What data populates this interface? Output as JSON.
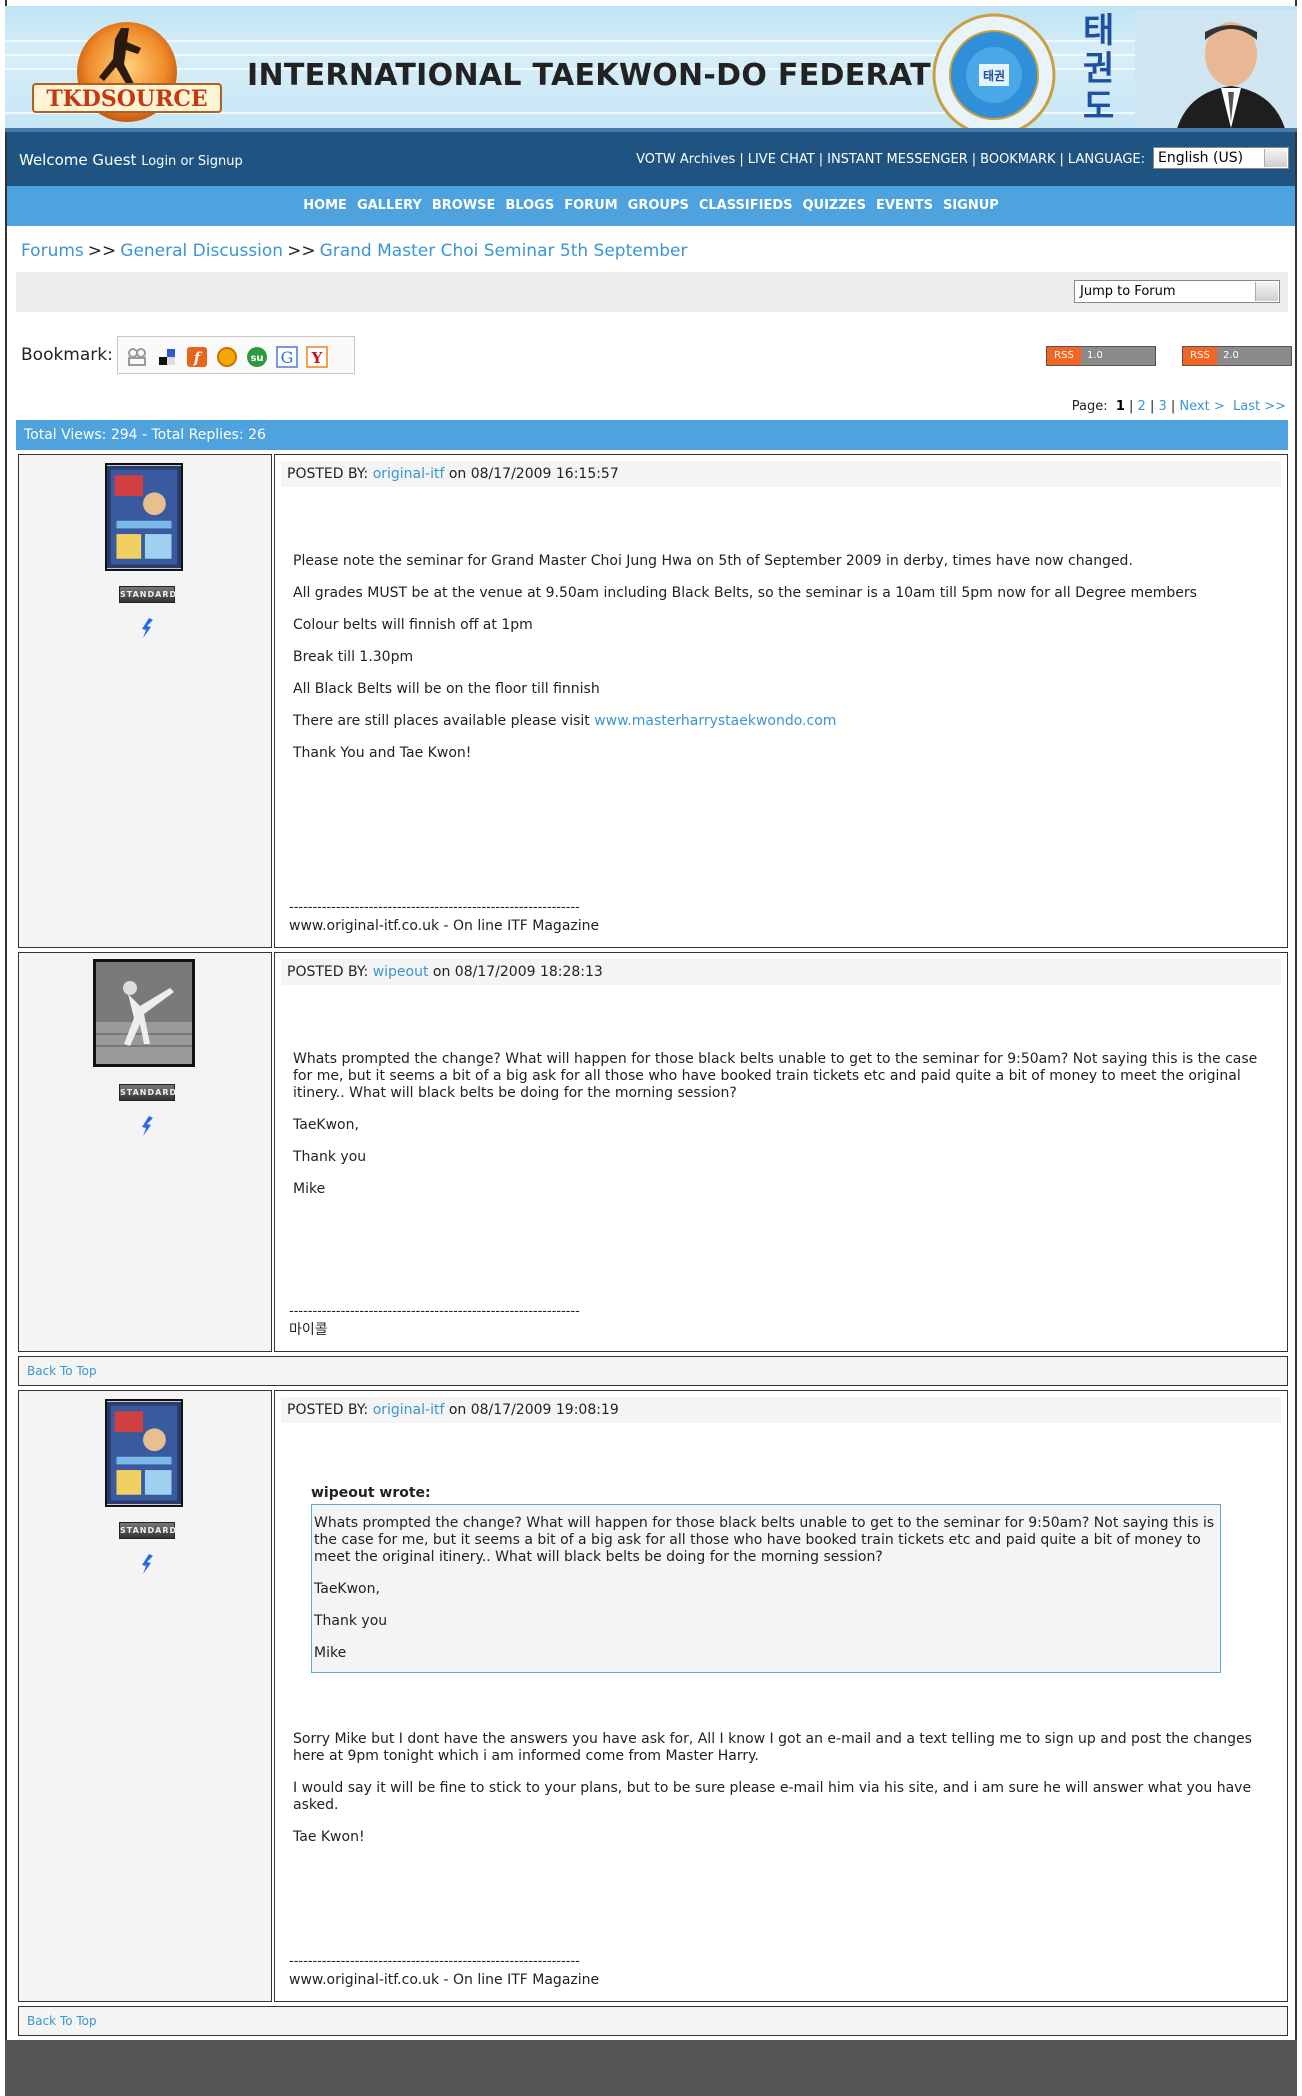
{
  "banner": {
    "logo_text": "TKDSOURCE",
    "title": "INTERNATIONAL TAEKWON-DO FEDERATION",
    "seal_text": "INTERNATIONAL TAEKWON-DO FEDERATION",
    "korean_vertical": "태권도"
  },
  "topbar": {
    "welcome": "Welcome Guest",
    "login": "Login",
    "or": "or",
    "signup": "Signup",
    "links": [
      "VOTW Archives",
      "LIVE CHAT",
      "INSTANT MESSENGER",
      "BOOKMARK"
    ],
    "language_label": "LANGUAGE:",
    "language_value": "English (US)"
  },
  "mainnav": [
    "HOME",
    "GALLERY",
    "BROWSE",
    "BLOGS",
    "FORUM",
    "GROUPS",
    "CLASSIFIEDS",
    "QUIZZES",
    "EVENTS",
    "SIGNUP"
  ],
  "breadcrumb": {
    "items": [
      "Forums",
      "General Discussion",
      "Grand Master Choi Seminar 5th September"
    ],
    "sep": ">>"
  },
  "jump": {
    "value": "Jump to Forum"
  },
  "bookmark": {
    "label": "Bookmark:",
    "services": [
      "digg-icon",
      "delicious-icon",
      "furl-icon",
      "blinklist-icon",
      "stumbleupon-icon",
      "google-icon",
      "yahoo-icon"
    ]
  },
  "rss": [
    {
      "tag": "RSS",
      "version": "1.0"
    },
    {
      "tag": "RSS",
      "version": "2.0"
    }
  ],
  "pagination": {
    "label": "Page:",
    "current": "1",
    "pages": [
      "2",
      "3"
    ],
    "next": "Next >",
    "last": "Last >>"
  },
  "stats": "Total Views: 294 - Total Replies: 26",
  "rank_label": "STANDARD",
  "posts": [
    {
      "posted_by_label": "POSTED BY:",
      "author": "original-itf",
      "on": "on 08/17/2009 16:15:57",
      "paragraphs": [
        "Please note the seminar for Grand Master Choi Jung Hwa on 5th of September 2009 in derby,  times have now changed.",
        "All grades MUST be at the venue at 9.50am including Black Belts, so the seminar is a 10am till 5pm now for all Degree members",
        "Colour belts will finnish off at 1pm",
        "Break till 1.30pm",
        "All Black Belts will be on the floor till finnish",
        "There are still places available please visit",
        "Thank You and Tae Kwon!"
      ],
      "link": "www.masterharrystaekwondo.com",
      "sig_dash": "--------------------------------------------------------------",
      "signature": "www.original-itf.co.uk - On line ITF Magazine"
    },
    {
      "posted_by_label": "POSTED BY:",
      "author": "wipeout",
      "on": "on 08/17/2009 18:28:13",
      "paragraphs": [
        "Whats prompted the change? What will happen for those black belts unable to get to the seminar for 9:50am? Not saying this is the case for me, but it seems a bit of a big ask for all those who have booked train tickets etc and paid quite a bit of money to meet the original itinery.. What will black belts be doing for the morning session?",
        "TaeKwon,",
        "Thank you",
        "Mike"
      ],
      "sig_dash": "--------------------------------------------------------------",
      "signature": "마이콜"
    },
    {
      "posted_by_label": "POSTED BY:",
      "author": "original-itf",
      "on": "on 08/17/2009 19:08:19",
      "quote_author": "wipeout wrote:",
      "quote_paragraphs": [
        "Whats prompted the change? What will happen for those black belts unable to get to the seminar for 9:50am? Not saying this is the case for me, but it seems a bit of a big ask for all those who have booked train tickets etc and paid quite a bit of money to meet the original itinery.. What will black belts be doing for the morning session?",
        "TaeKwon,",
        "Thank you",
        "Mike"
      ],
      "paragraphs": [
        "Sorry Mike but I dont have the answers you have ask for, All I know I got an e-mail and a text telling me to sign up and post the changes here at 9pm tonight which i am informed come from Master Harry.",
        "I would say it will be fine to stick to your plans, but to be sure please e-mail him via his site, and i am sure he will answer what you have asked.",
        "Tae Kwon!"
      ],
      "sig_dash": "--------------------------------------------------------------",
      "signature": "www.original-itf.co.uk - On line ITF Magazine"
    }
  ],
  "back_to_top": "Back To Top"
}
